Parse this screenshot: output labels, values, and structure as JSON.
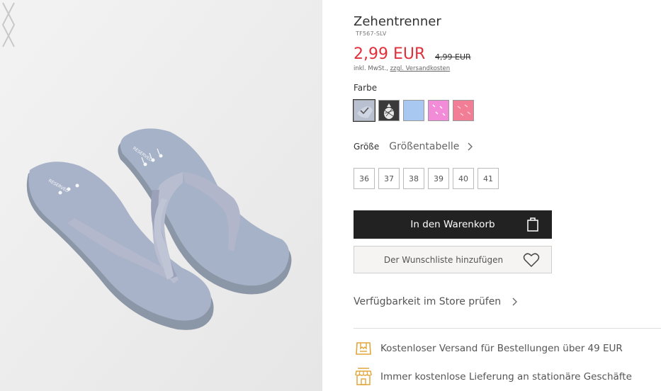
{
  "product": {
    "title": "Zehentrenner",
    "sku": "TF567-SLV",
    "price": "2,99 EUR",
    "old_price": "4,99 EUR",
    "tax_prefix": "inkl. MwSt., ",
    "shipping_link": "zzgl. Versandkosten"
  },
  "color": {
    "label": "Farbe",
    "swatches": [
      {
        "name": "silver-grey",
        "color": "#b9c0cf",
        "selected": true
      },
      {
        "name": "black-pineapple",
        "color": "#3a3a3a"
      },
      {
        "name": "light-blue",
        "color": "#a8c8f2"
      },
      {
        "name": "pink-pattern",
        "color": "#f28cd8"
      },
      {
        "name": "coral-pink",
        "color": "#f27e96"
      }
    ]
  },
  "size": {
    "label": "Größe",
    "chart_link": "Größentabelle",
    "options": [
      "36",
      "37",
      "38",
      "39",
      "40",
      "41"
    ]
  },
  "actions": {
    "add_to_cart": "In den Warenkorb",
    "add_to_wishlist": "Der Wunschliste hinzufügen",
    "store_check": "Verfügbarkeit im Store prüfen"
  },
  "benefits": [
    {
      "icon": "free-shipping-icon",
      "text": "Kostenloser Versand für Bestellungen über 49 EUR"
    },
    {
      "icon": "store-icon",
      "text": "Immer kostenlose Lieferung an stationäre Geschäfte"
    }
  ],
  "colors": {
    "accent_gold": "#e0a63a",
    "price_red": "#e0303c",
    "button_dark": "#222222"
  }
}
